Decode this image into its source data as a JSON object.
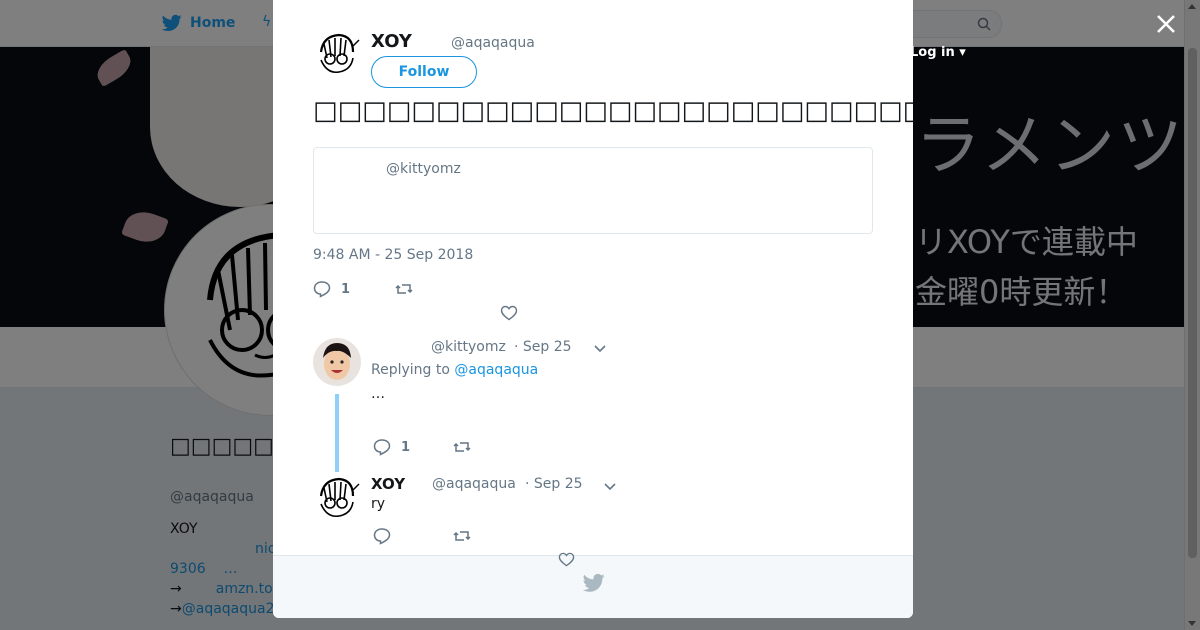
{
  "topbar": {
    "home_label": "Home",
    "login_label": "Log in"
  },
  "banner": {
    "line1": "ラメンツ",
    "line2": "リXOYで連載中",
    "line3": "金曜0時更新！"
  },
  "profile": {
    "name": "□□□□□□□□□□□□□□□□",
    "handle": "@aqaqaqua",
    "bio": {
      "line1": "XOY",
      "line2_link": "nic",
      "line3_a": "9306",
      "line3_b": "…",
      "line4_arrow": "→",
      "line4_link": "amzn.to",
      "line5_arrow": "→",
      "line5_link": "@aqaqaqua2"
    }
  },
  "tweet": {
    "author_name": "XOY",
    "author_handle": "@aqaqaqua",
    "follow_label": "Follow",
    "text": "□□□□□□□□□□□□□□□□□□□□□□□□□□□□□□□□□□□□□……",
    "quote_handle": "@kittyomz",
    "timestamp": "9:48 AM - 25 Sep 2018",
    "reply_count": "1"
  },
  "replies": [
    {
      "name": "",
      "handle": "@kittyomz",
      "date": "· Sep 25",
      "replying_prefix": "Replying to",
      "replying_to": "@aqaqaqua",
      "body": "…",
      "reply_count": "1"
    },
    {
      "name": "XOY",
      "handle": "@aqaqaqua",
      "date": "· Sep 25",
      "body": "ry"
    }
  ],
  "icons": {
    "close": "close-icon",
    "twitter": "twitter-bird-icon",
    "reply": "reply-icon",
    "retweet": "retweet-icon",
    "like": "heart-icon",
    "search": "search-icon"
  },
  "colors": {
    "accent": "#1b95e0",
    "thread": "#8ed0f9",
    "muted": "#657786"
  }
}
